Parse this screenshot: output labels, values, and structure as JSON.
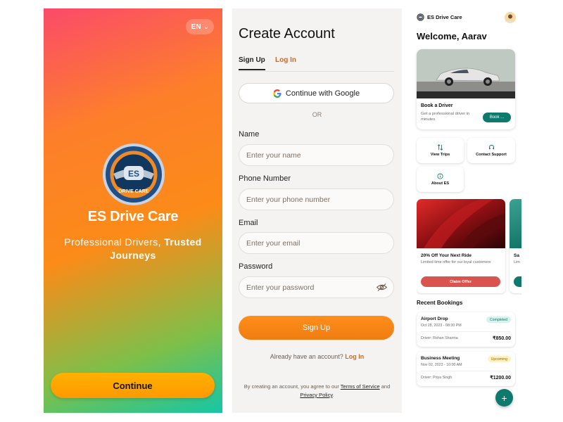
{
  "splash": {
    "language": "EN",
    "logo_text": "ES",
    "logo_ring_text": "DRIVE CARE",
    "brand": "ES Drive Care",
    "tagline_plain": "Professional Drivers,",
    "tagline_bold": "Trusted Journeys",
    "continue_label": "Continue"
  },
  "signup": {
    "title": "Create Account",
    "tabs": [
      {
        "label": "Sign Up",
        "active": true
      },
      {
        "label": "Log In",
        "active": false
      }
    ],
    "google_label": "Continue with Google",
    "or_text": "OR",
    "fields": [
      {
        "label": "Name",
        "placeholder": "Enter your name"
      },
      {
        "label": "Phone Number",
        "placeholder": "Enter your phone number"
      },
      {
        "label": "Email",
        "placeholder": "Enter your email"
      },
      {
        "label": "Password",
        "placeholder": "Enter your password",
        "icon": "eye-off-icon"
      }
    ],
    "submit_label": "Sign Up",
    "login_prompt": "Already have an account?",
    "login_link": "Log In",
    "terms_prefix": "By creating an account, you agree to our",
    "terms_link": "Terms of Service",
    "terms_and": "and",
    "privacy_link": "Privacy Policy",
    "terms_suffix": "."
  },
  "dashboard": {
    "brand": "ES Drive Care",
    "welcome": "Welcome, Aarav",
    "book_card": {
      "title": "Book a Driver",
      "description": "Get a professional driver in minutes",
      "button": "Book ..."
    },
    "quick_actions": [
      {
        "label": "View Trips",
        "icon": "swap-arrows-icon"
      },
      {
        "label": "Contact Support",
        "icon": "headset-icon"
      },
      {
        "label": "About ES",
        "icon": "info-icon"
      }
    ],
    "offers": [
      {
        "title": "20% Off Your Next Ride",
        "description": "Limited time offer for our loyal customers",
        "button": "Claim Offer"
      },
      {
        "title": "Sa",
        "description": "Lim"
      }
    ],
    "recent_title": "Recent Bookings",
    "bookings": [
      {
        "title": "Airport Drop",
        "date": "Oct 28, 2023 - 08:30 PM",
        "status": "Completed",
        "driver": "Driver: Rohan Sharma",
        "price": "₹850.00"
      },
      {
        "title": "Business Meeting",
        "date": "Nov 02, 2023 - 10:00 AM",
        "status": "Upcoming",
        "driver": "Driver: Priya Singh",
        "price": "₹1200.00"
      }
    ],
    "fab": "+"
  },
  "colors": {
    "accent_orange": "#ef7d10",
    "teal": "#0e7a6e",
    "offer_red": "#d9534f",
    "continue_yellow": "#ffa800"
  }
}
